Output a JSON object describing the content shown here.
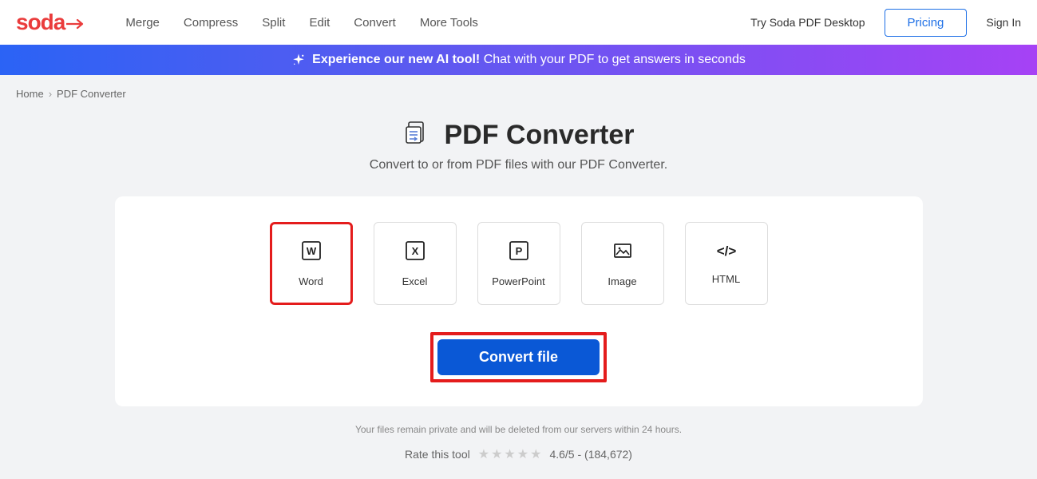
{
  "header": {
    "logo_text": "soda",
    "nav_items": [
      "Merge",
      "Compress",
      "Split",
      "Edit",
      "Convert",
      "More Tools"
    ],
    "try_desktop": "Try Soda PDF Desktop",
    "pricing": "Pricing",
    "signin": "Sign In"
  },
  "banner": {
    "bold": "Experience our new AI tool!",
    "rest": "Chat with your PDF to get answers in seconds"
  },
  "breadcrumb": {
    "items": [
      "Home",
      "PDF Converter"
    ]
  },
  "page": {
    "title": "PDF Converter",
    "subtitle": "Convert to or from PDF files with our PDF Converter."
  },
  "options": [
    {
      "label": "Word",
      "selected": true
    },
    {
      "label": "Excel",
      "selected": false
    },
    {
      "label": "PowerPoint",
      "selected": false
    },
    {
      "label": "Image",
      "selected": false
    },
    {
      "label": "HTML",
      "selected": false
    }
  ],
  "convert_button": "Convert file",
  "privacy": "Your files remain private and will be deleted from our servers within 24 hours.",
  "rating": {
    "label": "Rate this tool",
    "score": "4.6/5 - (184,672)"
  }
}
